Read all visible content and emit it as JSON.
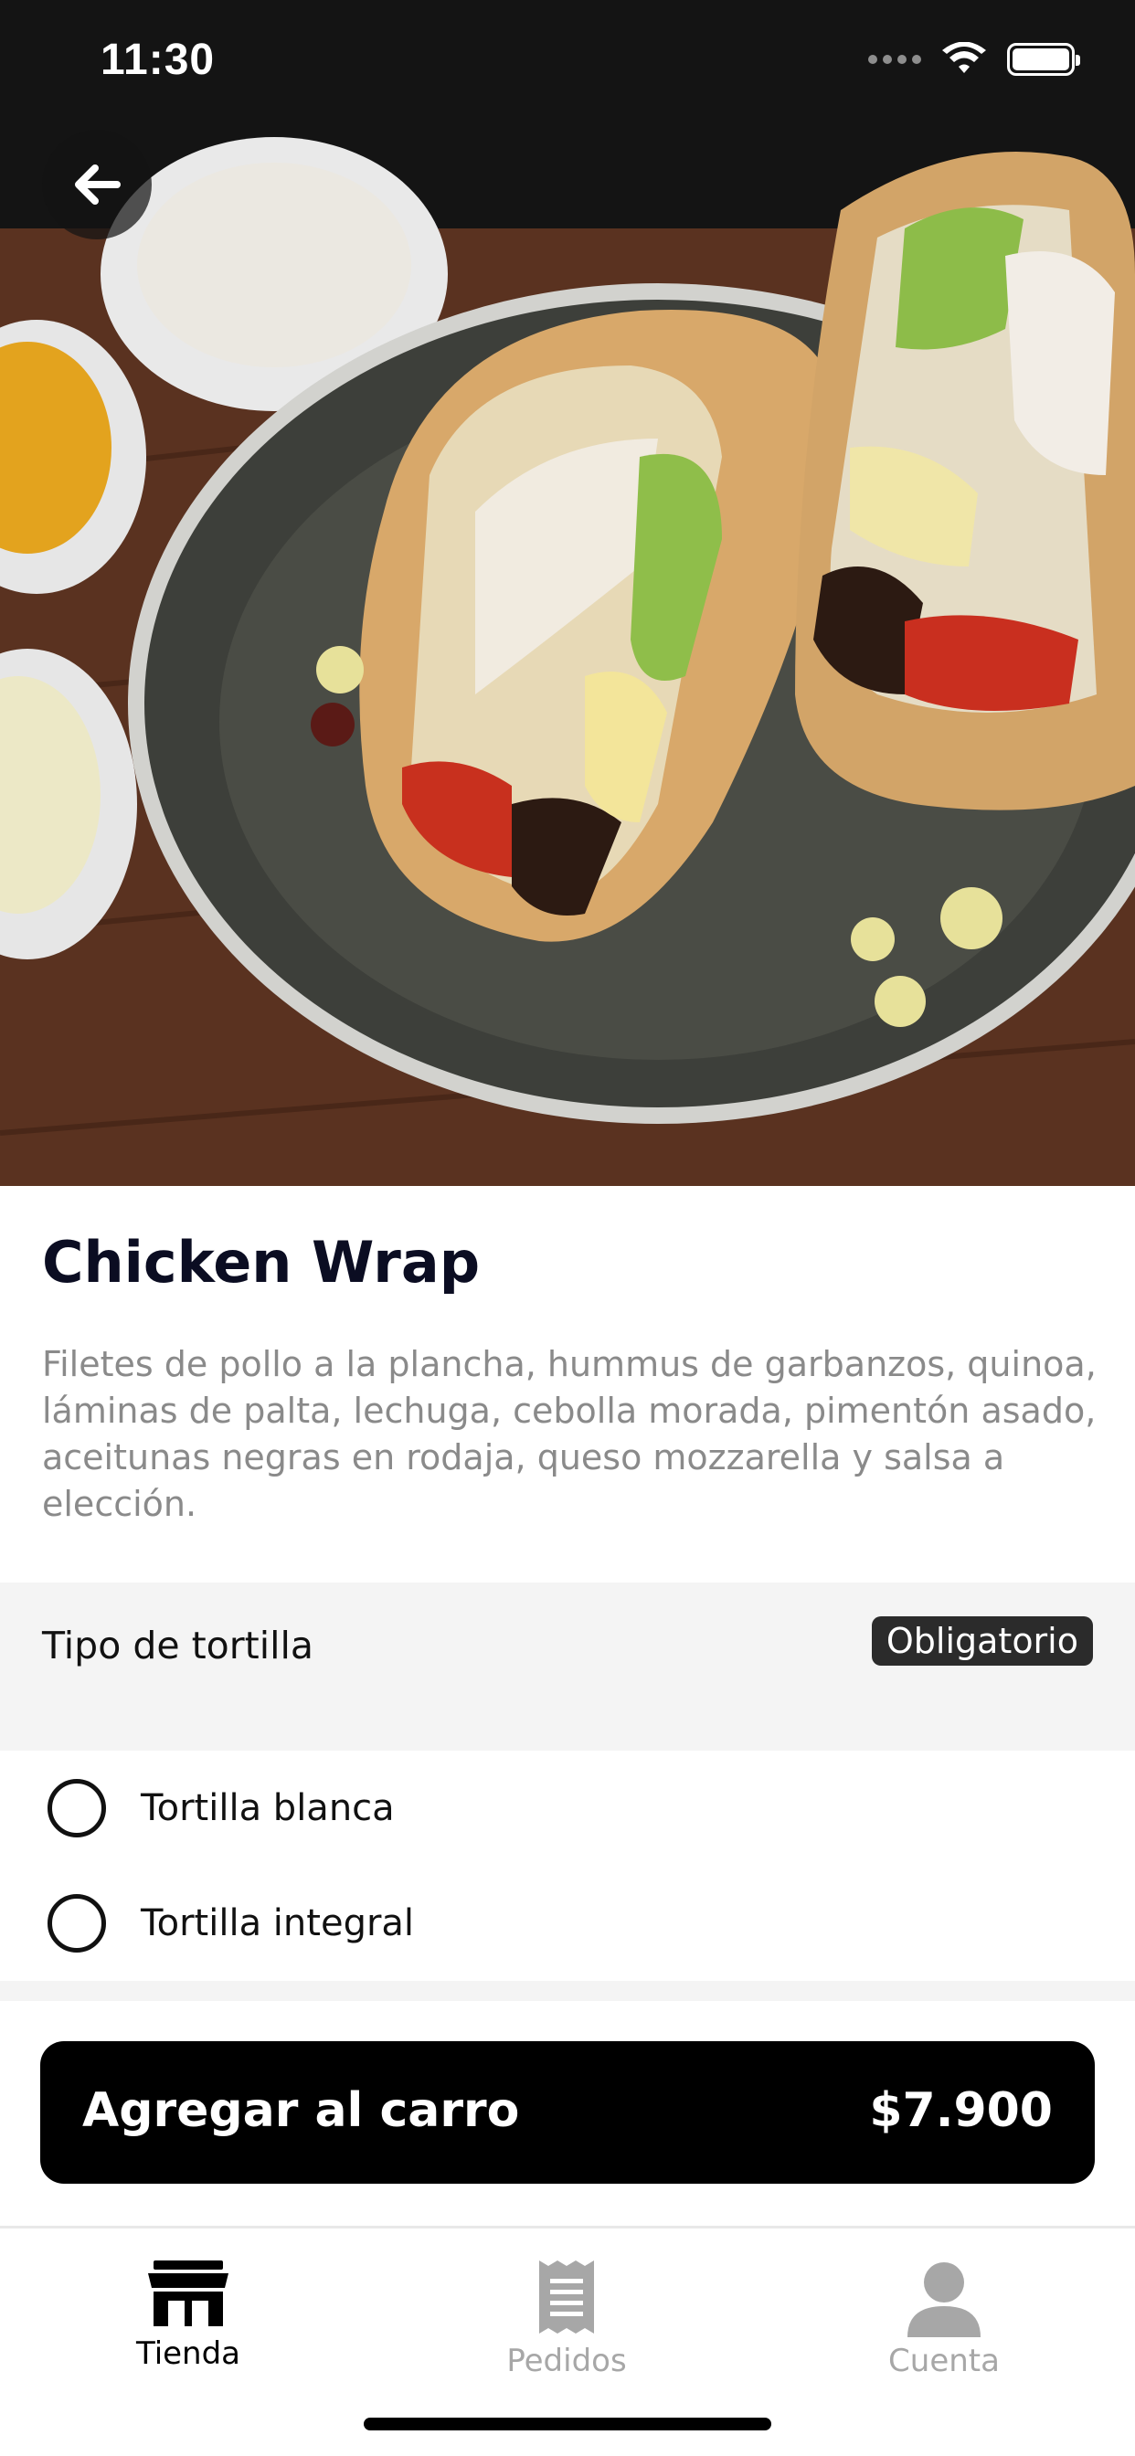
{
  "status_bar": {
    "time": "11:30"
  },
  "product": {
    "title": "Chicken Wrap",
    "description": "Filetes de pollo a la plancha, hummus de garbanzos, quinoa, láminas de palta, lechuga, cebolla morada, pimentón asado, aceitunas negras en rodaja, queso mozzarella y salsa a elección."
  },
  "options_section": {
    "title": "Tipo de tortilla",
    "badge": "Obligatorio",
    "options": [
      {
        "label": "Tortilla blanca",
        "selected": false
      },
      {
        "label": "Tortilla integral",
        "selected": false
      }
    ]
  },
  "cart_button": {
    "label": "Agregar al carro",
    "price": "$7.900"
  },
  "tabbar": {
    "tabs": [
      {
        "label": "Tienda",
        "icon": "store-icon",
        "active": true
      },
      {
        "label": "Pedidos",
        "icon": "receipt-icon",
        "active": false
      },
      {
        "label": "Cuenta",
        "icon": "person-icon",
        "active": false
      }
    ]
  },
  "colors": {
    "primary": "#000000",
    "title": "#0b0d22",
    "description": "#8a8a8a",
    "section_bg": "#f4f4f4",
    "inactive_tab": "#a7a7a7"
  }
}
